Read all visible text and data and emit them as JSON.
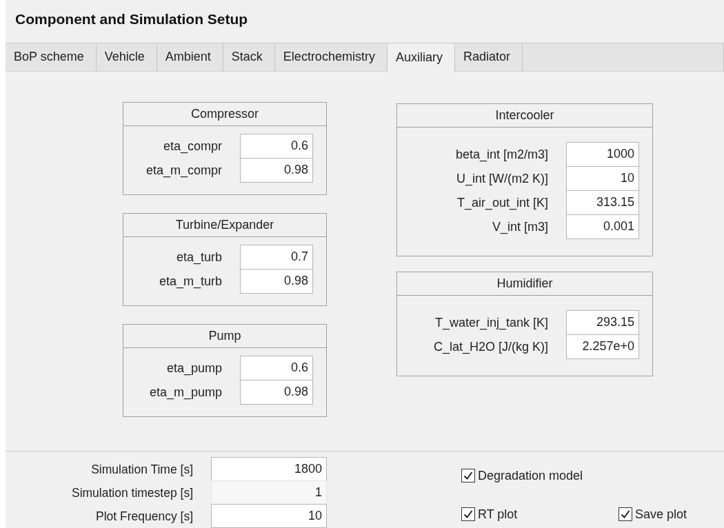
{
  "window": {
    "title": "Component and Simulation Setup"
  },
  "tabs": [
    {
      "label": "BoP scheme",
      "selected": false
    },
    {
      "label": "Vehicle",
      "selected": false
    },
    {
      "label": "Ambient",
      "selected": false
    },
    {
      "label": "Stack",
      "selected": false
    },
    {
      "label": "Electrochemistry",
      "selected": false
    },
    {
      "label": "Auxiliary",
      "selected": true
    },
    {
      "label": "Radiator",
      "selected": false
    }
  ],
  "left_panels": [
    {
      "title": "Compressor",
      "fields": [
        {
          "label": "eta_compr",
          "value": "0.6"
        },
        {
          "label": "eta_m_compr",
          "value": "0.98"
        }
      ]
    },
    {
      "title": "Turbine/Expander",
      "fields": [
        {
          "label": "eta_turb",
          "value": "0.7"
        },
        {
          "label": "eta_m_turb",
          "value": "0.98"
        }
      ]
    },
    {
      "title": "Pump",
      "fields": [
        {
          "label": "eta_pump",
          "value": "0.6"
        },
        {
          "label": "eta_m_pump",
          "value": "0.98"
        }
      ]
    }
  ],
  "right_panels": [
    {
      "title": "Intercooler",
      "fields": [
        {
          "label": "beta_int [m2/m3]",
          "value": "1000"
        },
        {
          "label": "U_int [W/(m2 K)]",
          "value": "10"
        },
        {
          "label": "T_air_out_int [K]",
          "value": "313.15"
        },
        {
          "label": "V_int [m3]",
          "value": "0.001"
        }
      ]
    },
    {
      "title": "Humidifier",
      "fields": [
        {
          "label": "T_water_inj_tank [K]",
          "value": "293.15"
        },
        {
          "label": "C_lat_H2O [J/(kg K)]",
          "value": "2.257e+0"
        }
      ]
    }
  ],
  "simulation": {
    "fields": [
      {
        "label": "Simulation Time [s]",
        "value": "1800",
        "disabled": false
      },
      {
        "label": "Simulation timestep [s]",
        "value": "1",
        "disabled": true
      },
      {
        "label": "Plot Frequency [s]",
        "value": "10",
        "disabled": false
      }
    ],
    "checkboxes": [
      {
        "label": "Degradation model",
        "checked": true
      },
      {
        "label": "RT plot",
        "checked": true
      },
      {
        "label": "Save plot",
        "checked": true
      }
    ]
  }
}
